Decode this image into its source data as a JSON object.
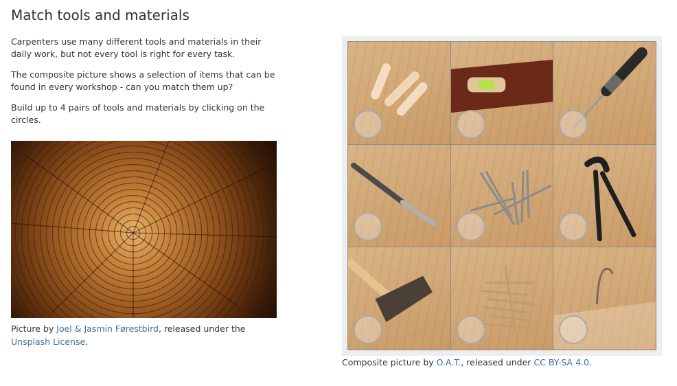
{
  "page": {
    "title": "Match tools and materials",
    "intro": [
      "Carpenters use many different tools and materials in their daily work, but not every tool is right for every task.",
      "The composite picture shows a selection of items that can be found in every workshop - can you match them up?",
      "Build up to 4 pairs of tools and materials by clicking on the circles."
    ]
  },
  "left_caption": {
    "prefix": "Picture by ",
    "author_link": "Joel & Jasmin Førestbird",
    "middle": ", released under the ",
    "license_link": "Unsplash License",
    "suffix": "."
  },
  "right_caption": {
    "prefix": "Composite picture by ",
    "author_link": "O.A.T.",
    "middle": ", released under ",
    "license_link": "CC BY-SA 4.0",
    "suffix": "."
  },
  "tiles": [
    {
      "item": "wooden-dowels",
      "icon": "dowels-icon"
    },
    {
      "item": "spirit-level",
      "icon": "spirit-level-icon"
    },
    {
      "item": "screwdriver",
      "icon": "screwdriver-icon"
    },
    {
      "item": "drill-bit",
      "icon": "drill-bit-icon"
    },
    {
      "item": "nails",
      "icon": "nails-icon"
    },
    {
      "item": "pincers",
      "icon": "pincers-icon"
    },
    {
      "item": "hammer",
      "icon": "hammer-icon"
    },
    {
      "item": "screws",
      "icon": "screws-icon"
    },
    {
      "item": "bent-nail",
      "icon": "bent-nail-icon"
    }
  ],
  "colors": {
    "link": "#3b6ea5",
    "frame": "#eeeeee",
    "circle_border": "#a9a9a9"
  }
}
